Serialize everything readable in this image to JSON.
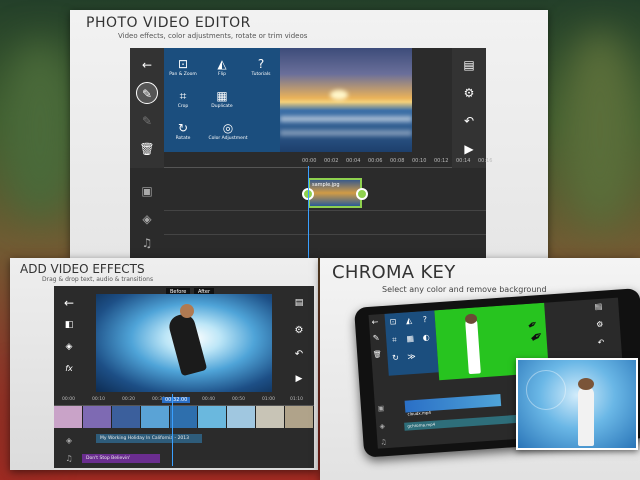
{
  "panel1": {
    "title": "PHOTO VIDEO EDITOR",
    "subtitle": "Video effects, color adjustments, rotate or trim videos",
    "menu": [
      {
        "label": "Pan & Zoom",
        "icon": "pan-zoom-icon",
        "glyph": "⊡"
      },
      {
        "label": "Flip",
        "icon": "flip-icon",
        "glyph": "◭"
      },
      {
        "label": "Tutorials",
        "icon": "help-icon",
        "glyph": "?"
      },
      {
        "label": "Crop",
        "icon": "crop-icon",
        "glyph": "⌗"
      },
      {
        "label": "Duplicate",
        "icon": "duplicate-icon",
        "glyph": "▦"
      },
      {
        "label": "Rotate",
        "icon": "rotate-icon",
        "glyph": "↻"
      },
      {
        "label": "Color Adjustment",
        "icon": "color-adjust-icon",
        "glyph": "◎"
      }
    ],
    "ruler": [
      "00:00",
      "00:02",
      "00:04",
      "00:06",
      "00:08",
      "00:10",
      "00:12",
      "00:14",
      "00:16"
    ],
    "clip_label": "sample.jpg"
  },
  "panel2": {
    "title": "ADD VIDEO EFFECTS",
    "subtitle": "Drag & drop text, audio & transitions",
    "before": "Before",
    "after": "After",
    "ruler": [
      "00:00",
      "00:10",
      "00:20",
      "00:30",
      "00:40",
      "00:50",
      "01:00",
      "01:10"
    ],
    "timecode": "00:32.00",
    "text_track": "My Working Holiday In California - 2013",
    "audio_track": "Don't Stop Believin'"
  },
  "panel3": {
    "title": "CHROMA KEY",
    "subtitle": "Select any color and remove background",
    "clip_top": "cloudx.mp4",
    "clip_bottom": "gchroma.mp4"
  },
  "colors": {
    "menu_blue": "#1b4e7e",
    "handle_green": "#8fd14f",
    "chroma_green": "#27c41f",
    "playhead": "#3aa0ff"
  }
}
